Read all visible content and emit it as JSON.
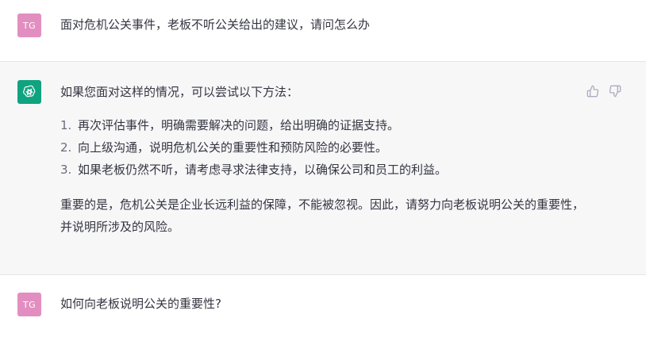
{
  "conversation": {
    "user1": {
      "avatar": "TG",
      "text": "面对危机公关事件，老板不听公关给出的建议，请问怎么办"
    },
    "assistant": {
      "intro": "如果您面对这样的情况，可以尝试以下方法：",
      "items": [
        {
          "num": "1.",
          "text": "再次评估事件，明确需要解决的问题，给出明确的证据支持。"
        },
        {
          "num": "2.",
          "text": "向上级沟通，说明危机公关的重要性和预防风险的必要性。"
        },
        {
          "num": "3.",
          "text": "如果老板仍然不听，请考虑寻求法律支持，以确保公司和员工的利益。"
        }
      ],
      "conclusion": "重要的是，危机公关是企业长远利益的保障，不能被忽视。因此，请努力向老板说明公关的重要性，并说明所涉及的风险。"
    },
    "user2": {
      "avatar": "TG",
      "text": "如何向老板说明公关的重要性?"
    }
  },
  "icons": {
    "assistant_avatar": "openai-logo-icon",
    "thumbs_up": "thumbs-up-icon",
    "thumbs_down": "thumbs-down-icon"
  },
  "colors": {
    "user_avatar_bg": "#e38ec0",
    "assistant_avatar_bg": "#10a37f",
    "assistant_row_bg": "#f7f7f8"
  }
}
